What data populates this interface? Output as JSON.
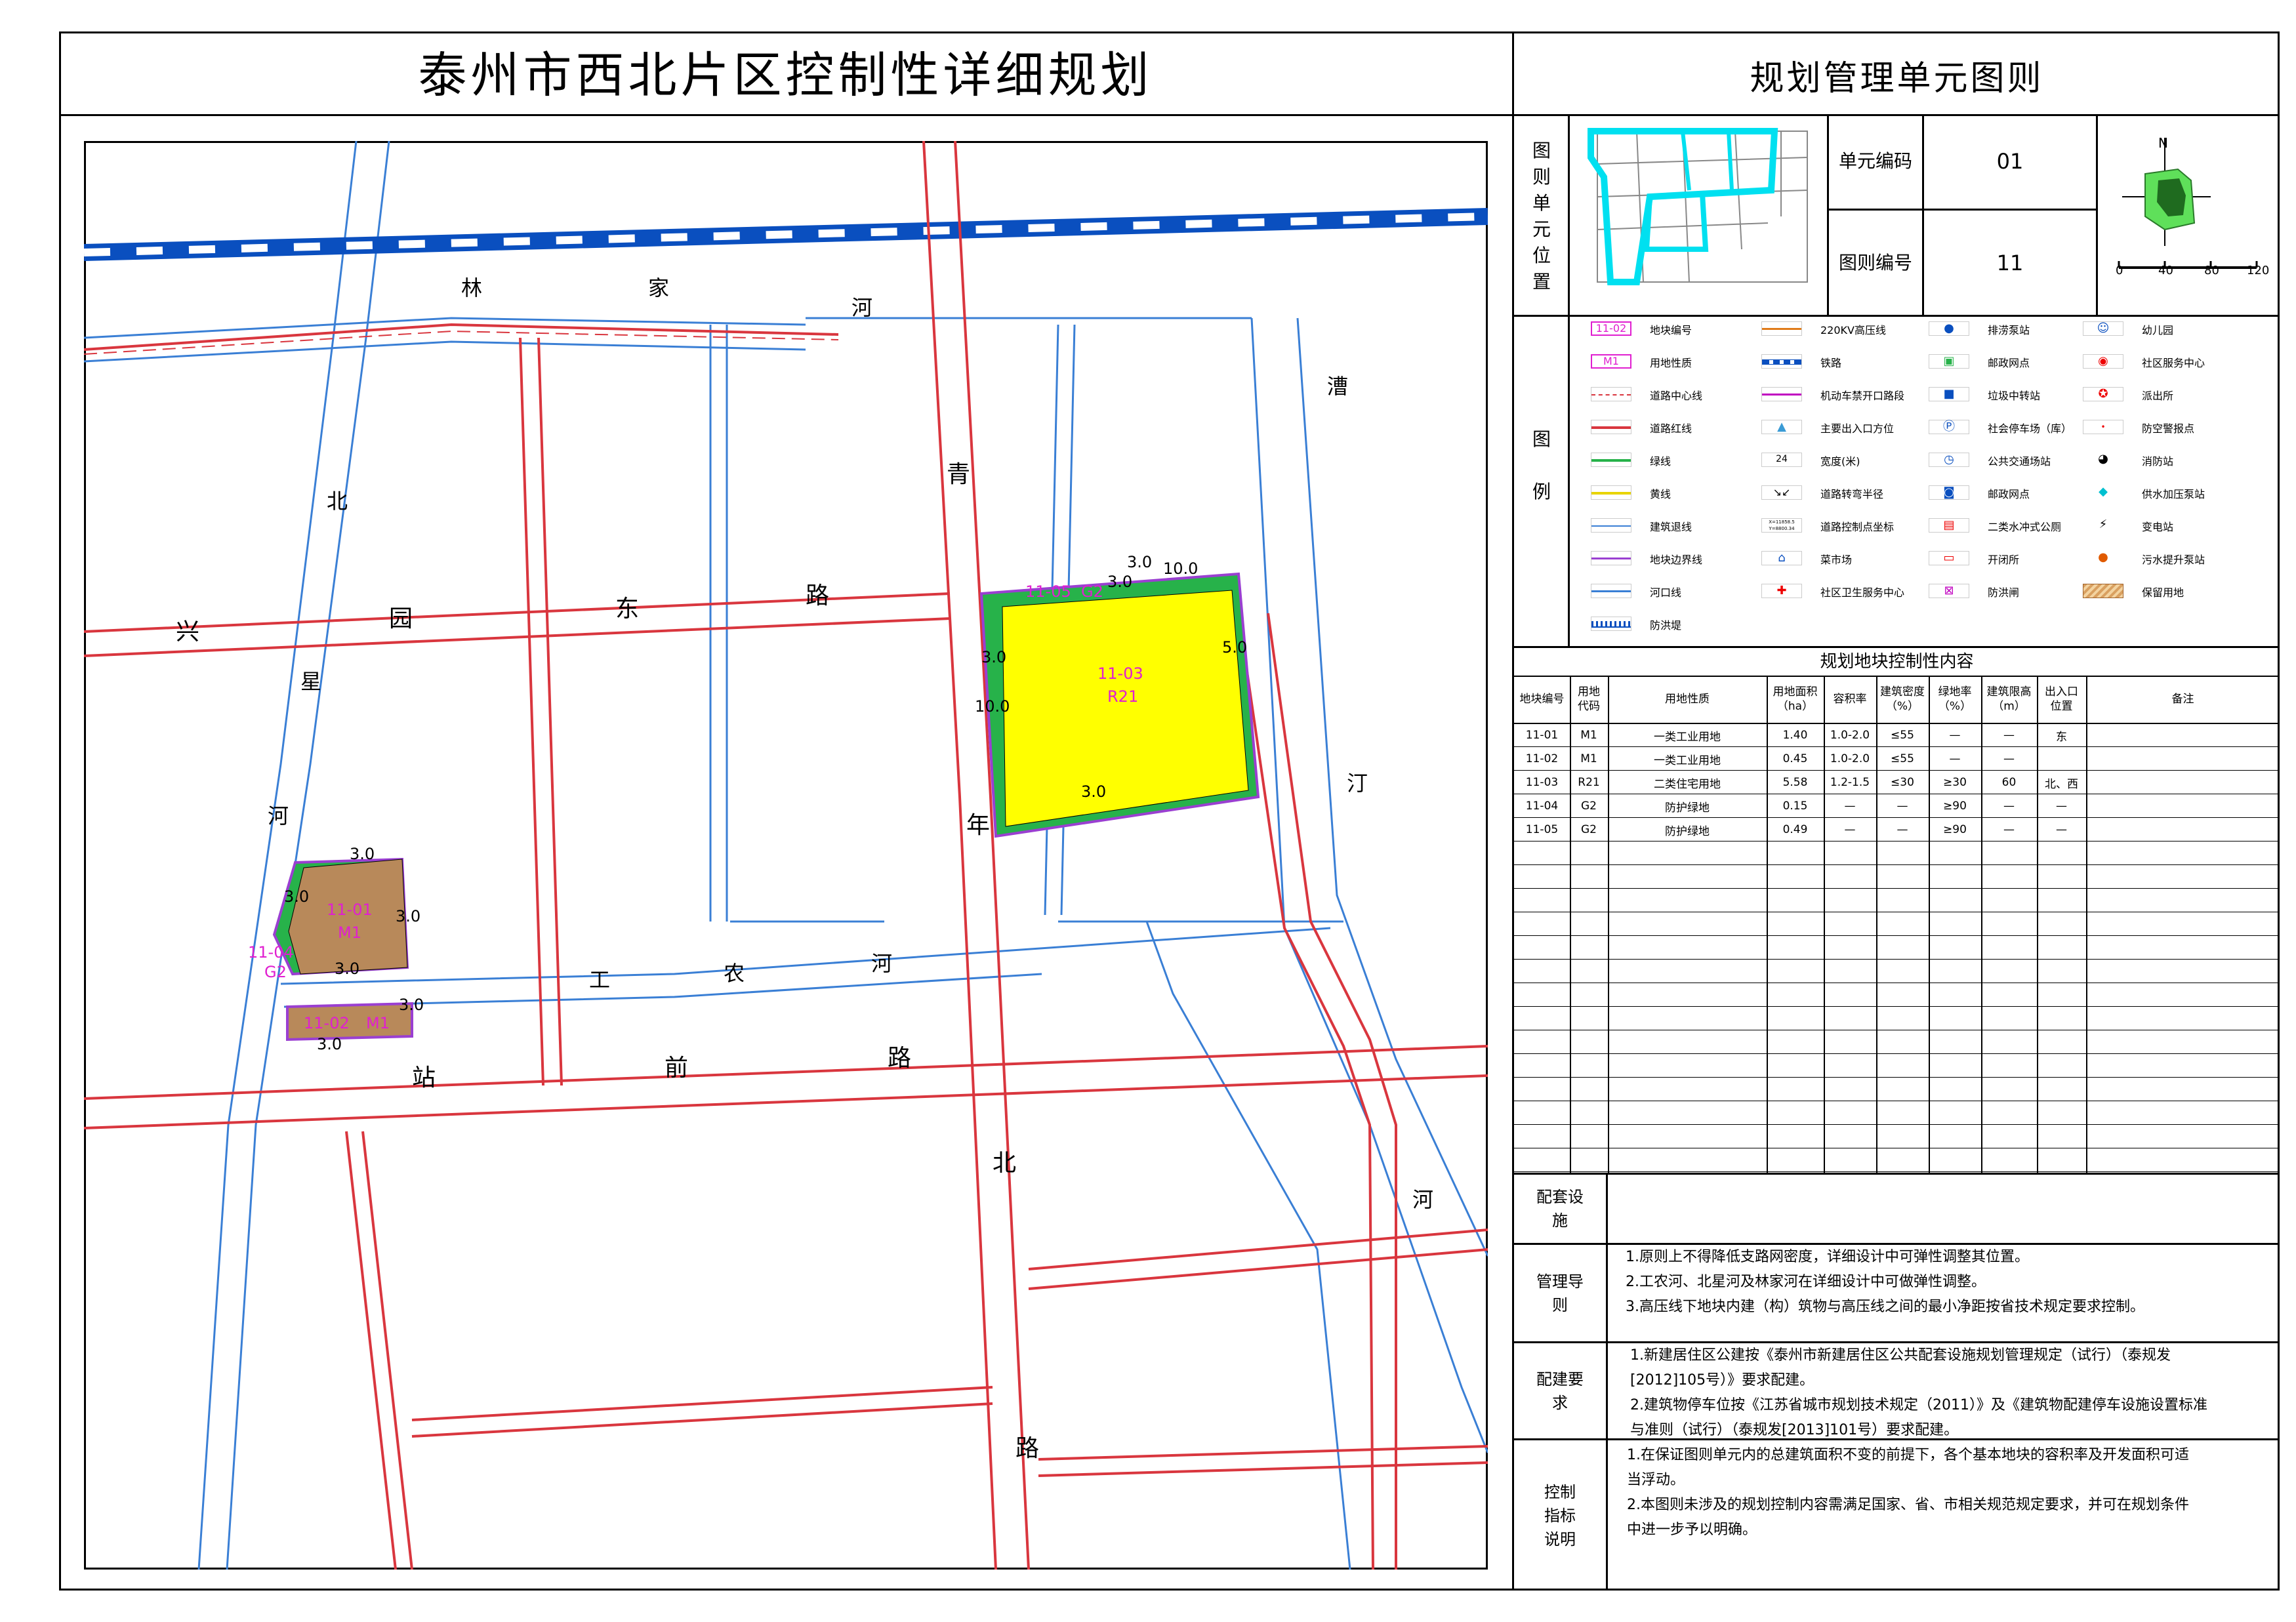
{
  "header": {
    "title": "泰州市西北片区控制性详细规划",
    "subtitle": "规划管理单元图则"
  },
  "unit_info": {
    "location_label": "图则单元位置",
    "unit_code_label": "单元编码",
    "unit_code_value": "01",
    "sheet_code_label": "图则编号",
    "sheet_code_value": "11",
    "north": "N",
    "scale_ticks": [
      "0",
      "40",
      "80",
      "120"
    ]
  },
  "map": {
    "roads": [
      "兴",
      "园",
      "东",
      "路",
      "站",
      "前",
      "路",
      "青",
      "年",
      "北",
      "路"
    ],
    "rivers": {
      "linjia": [
        "林",
        "家",
        "河"
      ],
      "beixing": [
        "北",
        "星",
        "河"
      ],
      "gongnong": [
        "工",
        "农",
        "河"
      ],
      "caoting": [
        "漕",
        "汀",
        "河"
      ]
    },
    "parcels": [
      {
        "code": "11-03",
        "use": "R21"
      },
      {
        "code": "11-01",
        "use": "M1"
      },
      {
        "code": "11-02",
        "use": "M1"
      },
      {
        "code": "11-04",
        "use": "G2"
      },
      {
        "code": "11-05",
        "use": "G2"
      }
    ],
    "setbacks": [
      "10.0",
      "3.0",
      "5.0",
      "3.0",
      "10.0",
      "3.0",
      "3.0",
      "3.0",
      "3.0",
      "3.0",
      "3.0",
      "3.0",
      "3.0"
    ]
  },
  "legend": {
    "label": "图例",
    "items": [
      {
        "text": "地块编号",
        "sym": "11-02"
      },
      {
        "text": "用地性质",
        "sym": "M1"
      },
      {
        "text": "道路中心线"
      },
      {
        "text": "道路红线"
      },
      {
        "text": "绿线"
      },
      {
        "text": "黄线"
      },
      {
        "text": "建筑退线"
      },
      {
        "text": "地块边界线"
      },
      {
        "text": "河口线"
      },
      {
        "text": "防洪堤"
      },
      {
        "text": "220KV高压线"
      },
      {
        "text": "铁路"
      },
      {
        "text": "机动车禁开口路段"
      },
      {
        "text": "主要出入口方位"
      },
      {
        "text": "宽度(米)",
        "sym": "24"
      },
      {
        "text": "道路转弯半径"
      },
      {
        "text": "道路控制点坐标",
        "sym": "X=11858.5 Y=8800.34"
      },
      {
        "text": "菜市场"
      },
      {
        "text": "社区卫生服务中心"
      },
      {
        "text": "排涝泵站"
      },
      {
        "text": "邮政网点"
      },
      {
        "text": "垃圾中转站"
      },
      {
        "text": "社会停车场（库）"
      },
      {
        "text": "公共交通场站"
      },
      {
        "text": "邮政网点"
      },
      {
        "text": "二类水冲式公厕"
      },
      {
        "text": "开闭所"
      },
      {
        "text": "防洪闸"
      },
      {
        "text": "幼儿园"
      },
      {
        "text": "社区服务中心"
      },
      {
        "text": "派出所"
      },
      {
        "text": "防空警报点"
      },
      {
        "text": "消防站"
      },
      {
        "text": "供水加压泵站"
      },
      {
        "text": "变电站"
      },
      {
        "text": "污水提升泵站"
      },
      {
        "text": "保留用地"
      }
    ]
  },
  "control_table": {
    "title": "规划地块控制性内容",
    "headers": [
      "地块编号",
      "用地代码",
      "用地性质",
      "用地面积（ha）",
      "容积率",
      "建筑密度（%）",
      "绿地率（%）",
      "建筑限高（m）",
      "出入口位置",
      "备注"
    ],
    "rows": [
      [
        "11-01",
        "M1",
        "一类工业用地",
        "1.40",
        "1.0-2.0",
        "≤55",
        "—",
        "—",
        "东",
        ""
      ],
      [
        "11-02",
        "M1",
        "一类工业用地",
        "0.45",
        "1.0-2.0",
        "≤55",
        "—",
        "—",
        "",
        ""
      ],
      [
        "11-03",
        "R21",
        "二类住宅用地",
        "5.58",
        "1.2-1.5",
        "≤30",
        "≥30",
        "60",
        "北、西",
        ""
      ],
      [
        "11-04",
        "G2",
        "防护绿地",
        "0.15",
        "—",
        "—",
        "≥90",
        "—",
        "—",
        ""
      ],
      [
        "11-05",
        "G2",
        "防护绿地",
        "0.49",
        "—",
        "—",
        "≥90",
        "—",
        "—",
        ""
      ]
    ]
  },
  "notes": {
    "facilities_label": "配套设施",
    "guide_label": "管理导则",
    "guide_lines": [
      "1.原则上不得降低支路网密度，详细设计中可弹性调整其位置。",
      "2.工农河、北星河及林家河在详细设计中可做弹性调整。",
      "3.高压线下地块内建（构）筑物与高压线之间的最小净距按省技术规定要求控制。"
    ],
    "req_label": "配建要求",
    "req_lines": [
      "1.新建居住区公建按《泰州市新建居住区公共配套设施规划管理规定（试行）（泰规发",
      "[2012]105号）》要求配建。",
      "2.建筑物停车位按《江苏省城市规划技术规定（2011）》及《建筑物配建停车设施设置标准",
      "与准则（试行）（泰规发[2013]101号）要求配建。"
    ],
    "expl_label": "控制指标说明",
    "expl_lines": [
      "1.在保证图则单元内的总建筑面积不变的前提下，各个基本地块的容积率及开发面积可适",
      "当浮动。",
      "2.本图则未涉及的规划控制内容需满足国家、省、市相关规范规定要求，并可在规划条件",
      "中进一步予以明确。"
    ]
  },
  "colors": {
    "road_red": "#d9363e",
    "river_blue": "#3a7fd5",
    "railway_blue": "#0a4fbf",
    "residential": "#ffff00",
    "industrial": "#b8895a",
    "green": "#27b24a",
    "parcel_purple": "#9a3fd1",
    "magenta_text": "#e01fd0"
  }
}
